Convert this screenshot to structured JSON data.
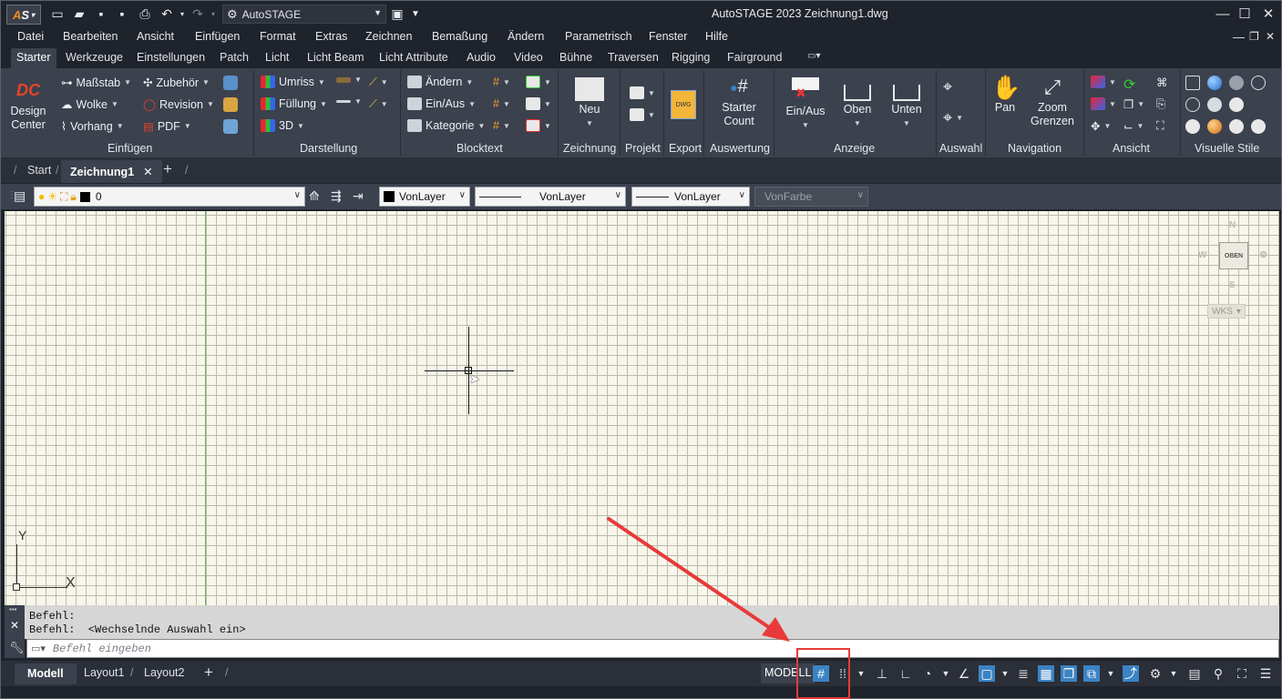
{
  "app": {
    "logo_text": "AS",
    "workspace": "AutoSTAGE",
    "title": "AutoSTAGE 2023   Zeichnung1.dwg"
  },
  "menu": [
    "Datei",
    "Bearbeiten",
    "Ansicht",
    "Einfügen",
    "Format",
    "Extras",
    "Zeichnen",
    "Bemaßung",
    "Ändern",
    "Parametrisch",
    "Fenster",
    "Hilfe"
  ],
  "ribbon_tabs": [
    "Starter",
    "Werkzeuge",
    "Einstellungen",
    "Patch",
    "Licht",
    "Licht Beam",
    "Licht Attribute",
    "Audio",
    "Video",
    "Bühne",
    "Traversen",
    "Rigging",
    "Fairground"
  ],
  "ribbon": {
    "einfuegen": {
      "title": "Einfügen",
      "design_center": "Design Center",
      "massstab": "Maßstab",
      "wolke": "Wolke",
      "vorhang": "Vorhang",
      "zubehoer": "Zubehör",
      "revision": "Revision",
      "pdf": "PDF"
    },
    "darstellung": {
      "title": "Darstellung",
      "umriss": "Umriss",
      "fuellung": "Füllung",
      "d3": "3D"
    },
    "blocktext": {
      "title": "Blocktext",
      "aendern": "Ändern",
      "einaus": "Ein/Aus",
      "kategorie": "Kategorie"
    },
    "zeichnung": {
      "title": "Zeichnung",
      "neu": "Neu"
    },
    "projekt": {
      "title": "Projekt"
    },
    "export": {
      "title": "Export",
      "dwg": "DWG"
    },
    "auswertung": {
      "title": "Auswertung",
      "starter_count": "Starter Count"
    },
    "anzeige": {
      "title": "Anzeige",
      "einaus": "Ein/Aus",
      "oben": "Oben",
      "unten": "Unten"
    },
    "auswahl": {
      "title": "Auswahl"
    },
    "navigation": {
      "title": "Navigation",
      "pan": "Pan",
      "zoom": "Zoom Grenzen"
    },
    "ansicht": {
      "title": "Ansicht"
    },
    "visuelle_stile": {
      "title": "Visuelle Stile"
    }
  },
  "doc_tabs": {
    "start": "Start",
    "active": "Zeichnung1"
  },
  "layerbar": {
    "layer": "0",
    "color": "VonLayer",
    "linetype": "VonLayer",
    "lineweight": "VonLayer",
    "plotstyle": "VonFarbe"
  },
  "viewcube": {
    "face": "OBEN",
    "n": "N",
    "s": "S",
    "w": "W",
    "wcs": "WKS"
  },
  "ucs": {
    "x": "X",
    "y": "Y"
  },
  "command": {
    "history": [
      "Befehl:",
      "Befehl:  <Wechselnde Auswahl ein>"
    ],
    "placeholder": "Befehl eingeben"
  },
  "layout_tabs": [
    "Modell",
    "Layout1",
    "Layout2"
  ],
  "status": {
    "model": "MODELL"
  },
  "colors": {
    "accent": "#3b83c4",
    "highlight": "#e83a3a",
    "canvas": "#f8f6ea"
  }
}
